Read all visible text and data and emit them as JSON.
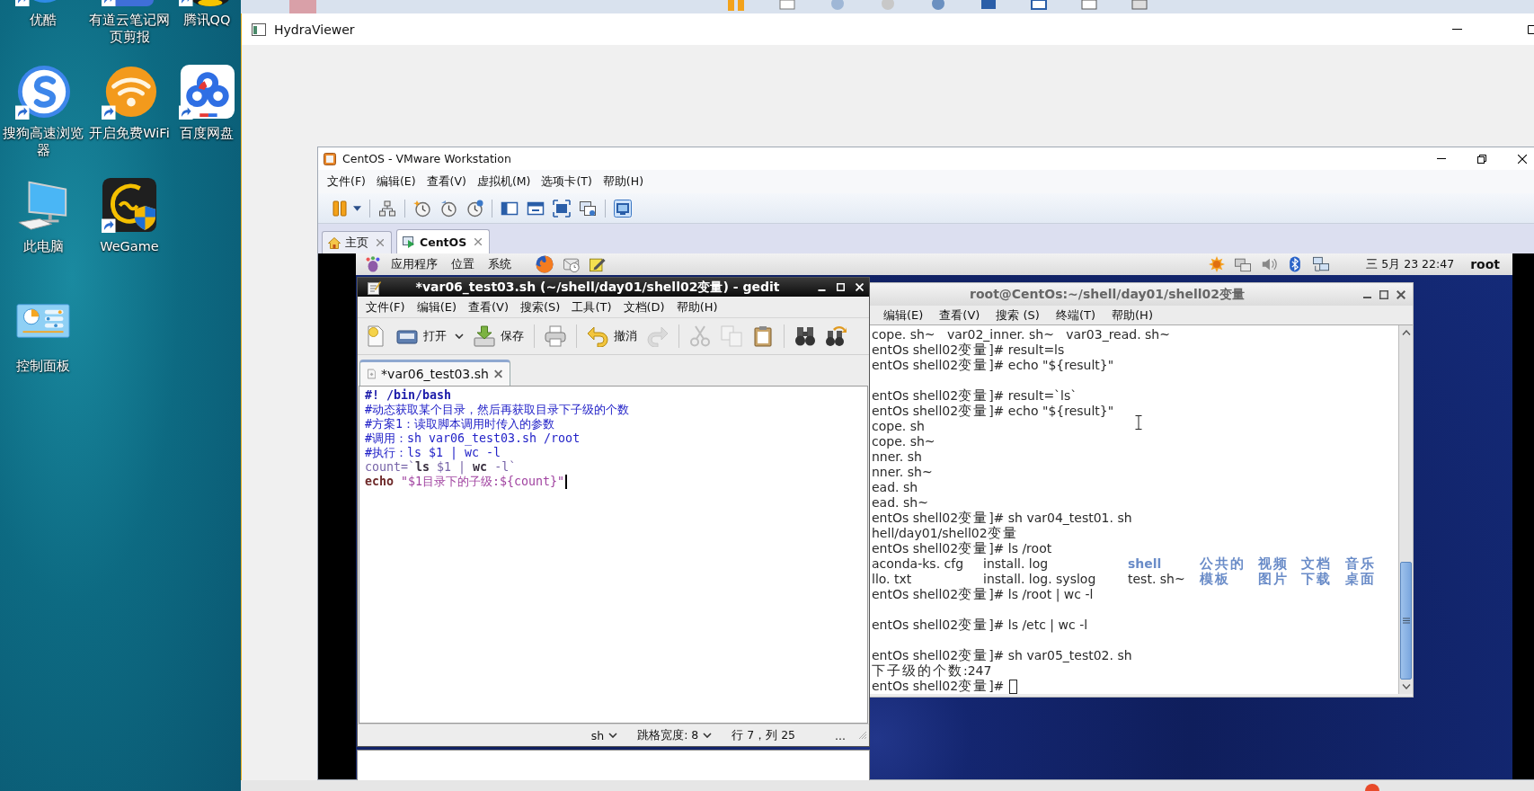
{
  "desktop": {
    "rows": [
      [
        {
          "label": "优酷",
          "kind": "youku",
          "shortcut": true
        },
        {
          "label": "有道云笔记网页剪报",
          "kind": "youdao",
          "shortcut": true
        },
        {
          "label": "腾讯QQ",
          "kind": "qq",
          "shortcut": true
        }
      ],
      [
        {
          "label": "搜狗高速浏览器",
          "kind": "sogou",
          "shortcut": true
        },
        {
          "label": "开启免费WiFi",
          "kind": "wifi",
          "shortcut": true
        },
        {
          "label": "百度网盘",
          "kind": "baidu",
          "shortcut": true
        }
      ],
      [
        {
          "label": "此电脑",
          "kind": "computer",
          "shortcut": false
        },
        {
          "label": "WeGame",
          "kind": "wegame",
          "shortcut": true
        }
      ],
      [
        {
          "label": "控制面板",
          "kind": "control-panel",
          "shortcut": false
        }
      ]
    ]
  },
  "viewer_window": {
    "title": "HydraViewer"
  },
  "vmware": {
    "title": "CentOS - VMware Workstation",
    "menu": [
      "文件(F)",
      "编辑(E)",
      "查看(V)",
      "虚拟机(M)",
      "选项卡(T)",
      "帮助(H)"
    ],
    "toolbar": [
      {
        "kind": "pause",
        "pressed": false
      },
      {
        "kind": "dropdown",
        "pressed": false
      },
      {
        "kind": "separator"
      },
      {
        "kind": "send-keys",
        "pressed": false
      },
      {
        "kind": "separator"
      },
      {
        "kind": "snapshot",
        "pressed": false
      },
      {
        "kind": "revert",
        "pressed": false
      },
      {
        "kind": "manager",
        "pressed": false
      },
      {
        "kind": "separator"
      },
      {
        "kind": "sidebar",
        "pressed": false
      },
      {
        "kind": "fit-window",
        "pressed": false
      },
      {
        "kind": "fullscreen",
        "pressed": false
      },
      {
        "kind": "unity",
        "pressed": false
      },
      {
        "kind": "separator"
      },
      {
        "kind": "console",
        "pressed": true
      }
    ],
    "tabs": [
      {
        "label": "主页",
        "kind": "home",
        "selected": false
      },
      {
        "label": "CentOS",
        "kind": "vm",
        "selected": true
      }
    ]
  },
  "guest": {
    "panel": {
      "menus": [
        "应用程序",
        "位置",
        "系统"
      ],
      "clock": "三 5月 23 22:47",
      "user": "root"
    },
    "gedit": {
      "title": "*var06_test03.sh (~/shell/day01/shell02变量) - gedit",
      "menu": [
        "文件(F)",
        "编辑(E)",
        "查看(V)",
        "搜索(S)",
        "工具(T)",
        "文档(D)",
        "帮助(H)"
      ],
      "toolbar": [
        {
          "kind": "new",
          "disabled": false
        },
        {
          "kind": "open",
          "label": "打开",
          "disabled": false
        },
        {
          "kind": "dropdown",
          "disabled": false
        },
        {
          "kind": "save",
          "label": "保存",
          "disabled": false
        },
        {
          "kind": "separator"
        },
        {
          "kind": "print",
          "disabled": false
        },
        {
          "kind": "separator"
        },
        {
          "kind": "undo",
          "label": "撤消",
          "disabled": false
        },
        {
          "kind": "redo",
          "disabled": true
        },
        {
          "kind": "separator"
        },
        {
          "kind": "cut",
          "disabled": true
        },
        {
          "kind": "copy",
          "disabled": true
        },
        {
          "kind": "paste",
          "disabled": false
        },
        {
          "kind": "separator"
        },
        {
          "kind": "find",
          "disabled": false
        },
        {
          "kind": "replace",
          "disabled": false
        }
      ],
      "tab": {
        "label": "*var06_test03.sh"
      },
      "lines": [
        {
          "caret": false,
          "segments": [
            {
              "text": "#! /bin/bash",
              "kind": "shebang"
            }
          ]
        },
        {
          "caret": false,
          "segments": [
            {
              "text": "#动态获取某个目录，然后再获取目录下子级的个数",
              "kind": "comment"
            }
          ]
        },
        {
          "caret": false,
          "segments": [
            {
              "text": "#方案1：读取脚本调用时传入的参数",
              "kind": "comment"
            }
          ]
        },
        {
          "caret": false,
          "segments": [
            {
              "text": "#调用：sh var06_test03.sh /root",
              "kind": "comment"
            }
          ]
        },
        {
          "caret": false,
          "segments": [
            {
              "text": "#执行：ls $1 | wc -l",
              "kind": "comment"
            }
          ]
        },
        {
          "caret": false,
          "segments": [
            {
              "text": "count=`",
              "kind": "variable"
            },
            {
              "text": "ls",
              "kind": "command"
            },
            {
              "text": " $1 | ",
              "kind": "plain"
            },
            {
              "text": "wc",
              "kind": "command"
            },
            {
              "text": " -l`",
              "kind": "plain"
            }
          ]
        },
        {
          "caret": true,
          "segments": [
            {
              "text": "echo",
              "kind": "keyword"
            },
            {
              "text": " \"$1目录下的子级:${count}\"",
              "kind": "string"
            }
          ]
        }
      ],
      "status": {
        "language": "sh",
        "tab_width": "跳格宽度: 8",
        "position": "行 7，列 25",
        "more": "..."
      }
    },
    "terminal": {
      "title": "root@CentOs:~/shell/day01/shell02变量",
      "menu": [
        "编辑(E)",
        "查看(V)",
        "搜索 (S)",
        "终端(T)",
        "帮助(H)"
      ],
      "lines": [
        {
          "kind": "text",
          "text": "cope. sh~   var02_inner. sh~   var03_read. sh~",
          "cursor": false
        },
        {
          "kind": "text",
          "text": "entOs shell02变量]# result=ls",
          "cursor": false
        },
        {
          "kind": "text",
          "text": "entOs shell02变量]# echo \"${result}\"",
          "cursor": false
        },
        {
          "kind": "blank"
        },
        {
          "kind": "text",
          "text": "entOs shell02变量]# result=`ls`",
          "cursor": false
        },
        {
          "kind": "text",
          "text": "entOs shell02变量]# echo \"${result}\"",
          "cursor": false
        },
        {
          "kind": "text",
          "text": "cope. sh",
          "cursor": false
        },
        {
          "kind": "text",
          "text": "cope. sh~",
          "cursor": false
        },
        {
          "kind": "text",
          "text": "nner. sh",
          "cursor": false
        },
        {
          "kind": "text",
          "text": "nner. sh~",
          "cursor": false
        },
        {
          "kind": "text",
          "text": "ead. sh",
          "cursor": false
        },
        {
          "kind": "text",
          "text": "ead. sh~",
          "cursor": false
        },
        {
          "kind": "text",
          "text": "entOs shell02变量]# sh var04_test01. sh",
          "cursor": false
        },
        {
          "kind": "text",
          "text": "hell/day01/shell02变量",
          "cursor": false
        },
        {
          "kind": "text",
          "text": "entOs shell02变量]# ls /root",
          "cursor": false
        },
        {
          "kind": "columns",
          "cells": [
            {
              "text": "aconda-ks. cfg",
              "kind": "file"
            },
            {
              "text": "install. log",
              "kind": "file"
            },
            {
              "text": "shell",
              "kind": "directory"
            },
            {
              "text": "公共的",
              "kind": "directory"
            },
            {
              "text": "视频",
              "kind": "directory"
            },
            {
              "text": "文档",
              "kind": "directory"
            },
            {
              "text": "音乐",
              "kind": "directory"
            }
          ]
        },
        {
          "kind": "columns",
          "cells": [
            {
              "text": "llo. txt",
              "kind": "file"
            },
            {
              "text": "install. log. syslog",
              "kind": "file"
            },
            {
              "text": "test. sh~",
              "kind": "file"
            },
            {
              "text": "模板",
              "kind": "directory"
            },
            {
              "text": "图片",
              "kind": "directory"
            },
            {
              "text": "下载",
              "kind": "directory"
            },
            {
              "text": "桌面",
              "kind": "directory"
            }
          ]
        },
        {
          "kind": "text",
          "text": "entOs shell02变量]# ls /root | wc -l",
          "cursor": false
        },
        {
          "kind": "blank"
        },
        {
          "kind": "text",
          "text": "entOs shell02变量]# ls /etc | wc -l",
          "cursor": false
        },
        {
          "kind": "blank"
        },
        {
          "kind": "text",
          "text": "entOs shell02变量]# sh var05_test02. sh",
          "cursor": false
        },
        {
          "kind": "text",
          "text": "下子级的个数:247",
          "cursor": false
        },
        {
          "kind": "text",
          "text": "entOs shell02变量]#",
          "cursor": true
        }
      ]
    }
  }
}
